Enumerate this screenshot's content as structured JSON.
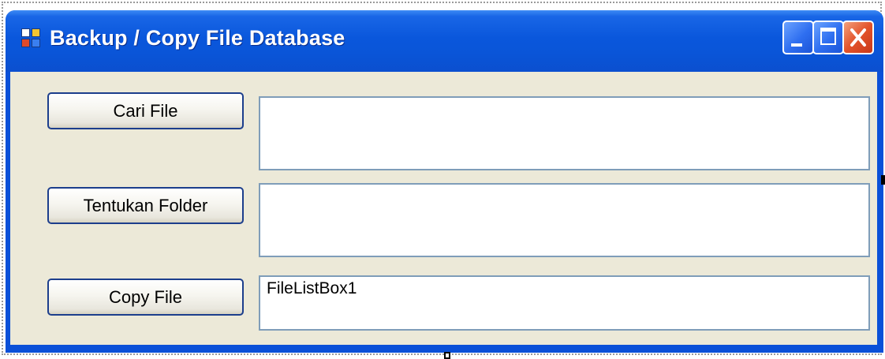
{
  "window": {
    "title": "Backup / Copy File Database",
    "icon": "app-window-icon",
    "controls": {
      "minimize_icon": "minimize-icon",
      "maximize_icon": "maximize-icon",
      "close_icon": "close-icon"
    }
  },
  "form": {
    "find_file_button": "Cari File",
    "set_folder_button": "Tentukan Folder",
    "copy_file_button": "Copy File",
    "file_path_text": "",
    "folder_path_text": "",
    "file_list_box_text": "FileListBox1"
  },
  "colors": {
    "titlebar": "#0a55d8",
    "client_area": "#ece9d8",
    "close_button": "#e3532a",
    "button_border": "#1c3e8c",
    "textbox_border": "#7f9db9"
  }
}
